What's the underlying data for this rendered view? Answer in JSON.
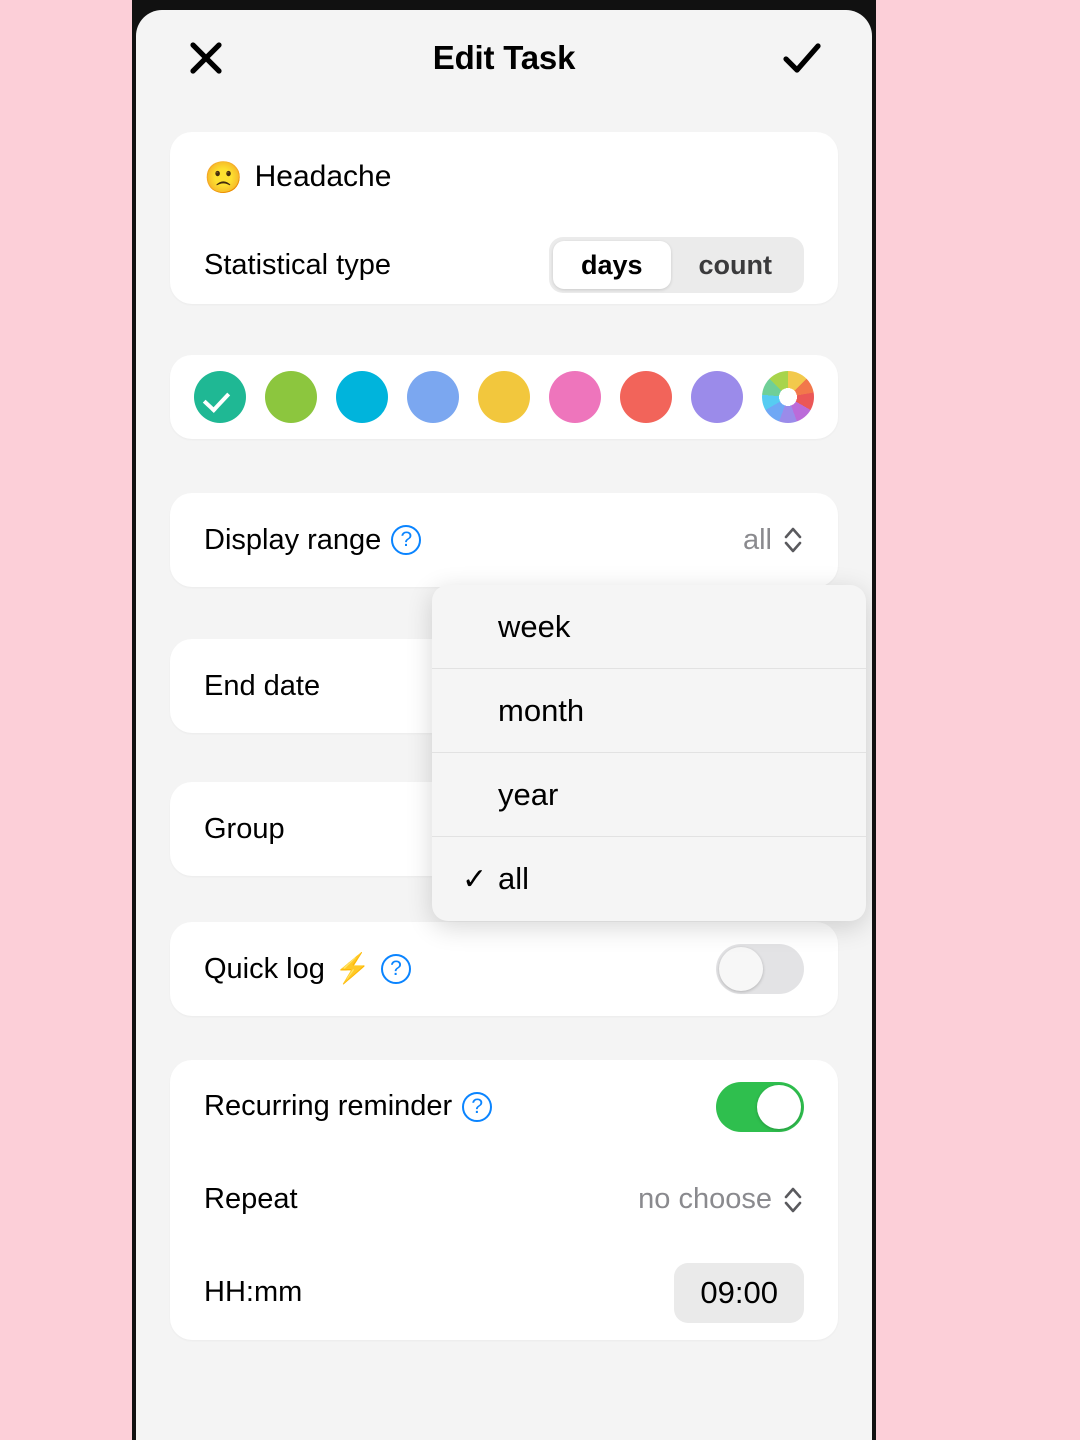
{
  "background_color": "#FCCFD8",
  "header": {
    "title": "Edit Task",
    "close_icon": "close-x-icon",
    "confirm_icon": "checkmark-icon"
  },
  "task": {
    "emoji": "🙁",
    "name": "Headache",
    "statistical_type": {
      "label": "Statistical type",
      "options": [
        "days",
        "count"
      ],
      "selected": "days"
    }
  },
  "colors": {
    "selected_index": 0,
    "swatches": [
      {
        "name": "teal-green",
        "hex": "#1FB894",
        "selected": true
      },
      {
        "name": "olive-green",
        "hex": "#8CC63E",
        "selected": false
      },
      {
        "name": "cyan",
        "hex": "#00B4DC",
        "selected": false
      },
      {
        "name": "blue",
        "hex": "#7BA7F0",
        "selected": false
      },
      {
        "name": "yellow",
        "hex": "#F2C73D",
        "selected": false
      },
      {
        "name": "pink",
        "hex": "#EE75BC",
        "selected": false
      },
      {
        "name": "coral-red",
        "hex": "#F2645A",
        "selected": false
      },
      {
        "name": "purple",
        "hex": "#9B8BEA",
        "selected": false
      },
      {
        "name": "color-wheel",
        "hex": "multicolor",
        "selected": false
      }
    ]
  },
  "settings": {
    "display_range": {
      "label": "Display range",
      "value": "all",
      "has_help": true
    },
    "end_date": {
      "label": "End date"
    },
    "group": {
      "label": "Group"
    },
    "quick_log": {
      "label": "Quick log",
      "emoji": "⚡",
      "has_help": true,
      "enabled": false
    }
  },
  "dropdown": {
    "open": true,
    "items": [
      {
        "label": "week",
        "checked": false
      },
      {
        "label": "month",
        "checked": false
      },
      {
        "label": "year",
        "checked": false
      },
      {
        "label": "all",
        "checked": true
      }
    ],
    "check_glyph": "✓"
  },
  "reminder": {
    "title": "Recurring reminder",
    "enabled": true,
    "repeat": {
      "label": "Repeat",
      "value": "no choose"
    },
    "time": {
      "label": "HH:mm",
      "value": "09:00"
    }
  },
  "accent_colors": {
    "help_blue": "#0A84FF",
    "toggle_on_green": "#2FBF4E",
    "toggle_off_gray": "#E3E3E5"
  }
}
